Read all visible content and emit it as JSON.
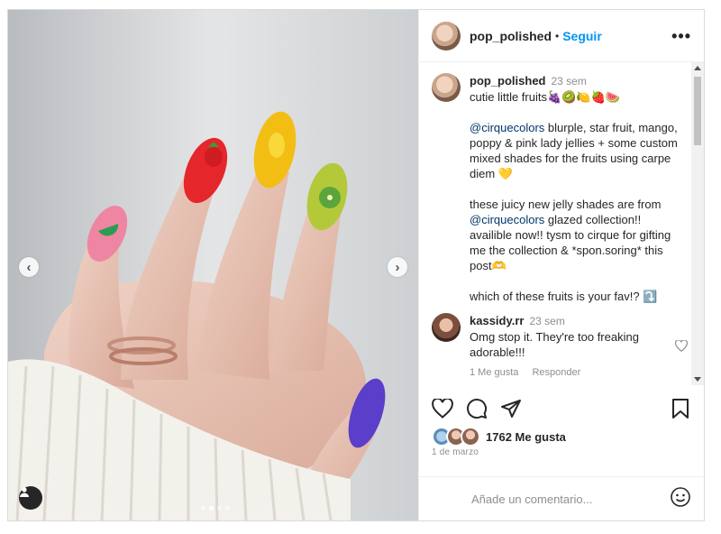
{
  "header": {
    "username": "pop_polished",
    "separator": "•",
    "follow_label": "Seguir",
    "more_label": "•••"
  },
  "caption": {
    "username": "pop_polished",
    "time": "23 sem",
    "line1": "cutie little fruits🍇🥝🍋🍓🍉",
    "mention1": "@cirquecolors",
    "para1": " blurple, star fruit, mango, poppy & pink lady jellies + some custom mixed shades for the fruits using carpe diem 💛",
    "para2_intro": "these juicy new jelly shades are from ",
    "mention2": "@cirquecolors",
    "para2": " glazed collection!! availible now!! tysm to cirque for gifting me the collection & *spon.soring* this post🫶",
    "para3": "which of these fruits is your fav!? ⤵️"
  },
  "comment2": {
    "username": "kassidy.rr",
    "time": "23 sem",
    "text": "Omg stop it. They're too freaking adorable!!!",
    "likes_label": "1 Me gusta",
    "reply_label": "Responder"
  },
  "actions": {
    "like_icon": "heart-outline",
    "comment_icon": "speech-bubble",
    "share_icon": "paper-plane",
    "save_icon": "bookmark"
  },
  "likes_count": "1762 Me gusta",
  "date": "1 de marzo",
  "add_comment_placeholder": "Añade un comentario...",
  "photo": {
    "slide_count": 4,
    "active_slide": 2,
    "prev_arrow": "‹",
    "next_arrow": "›"
  },
  "colors": {
    "link": "#0095f6",
    "mention": "#00376b",
    "muted": "#8e8e8e",
    "text": "#262626"
  }
}
